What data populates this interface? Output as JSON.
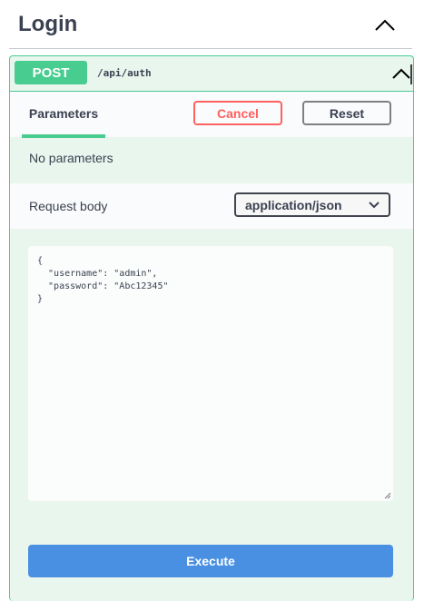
{
  "section": {
    "title": "Login"
  },
  "operation": {
    "method": "POST",
    "path": "/api/auth"
  },
  "tabs": {
    "parameters_label": "Parameters"
  },
  "buttons": {
    "cancel": "Cancel",
    "reset": "Reset",
    "execute": "Execute"
  },
  "parameters": {
    "empty_text": "No parameters"
  },
  "request_body": {
    "label": "Request body",
    "content_type": "application/json",
    "content_type_options": [
      "application/json"
    ],
    "value": "{\n  \"username\": \"admin\",\n  \"password\": \"Abc12345\"\n}"
  },
  "icons": {
    "section_toggle": "chevron-up-icon",
    "operation_toggle": "chevron-up-icon",
    "select_arrow": "chevron-down-icon"
  },
  "colors": {
    "post_method": "#49cc90",
    "post_background": "#e8f6ee",
    "cancel": "#ff6060",
    "execute": "#4990e2",
    "text": "#3b4151"
  }
}
